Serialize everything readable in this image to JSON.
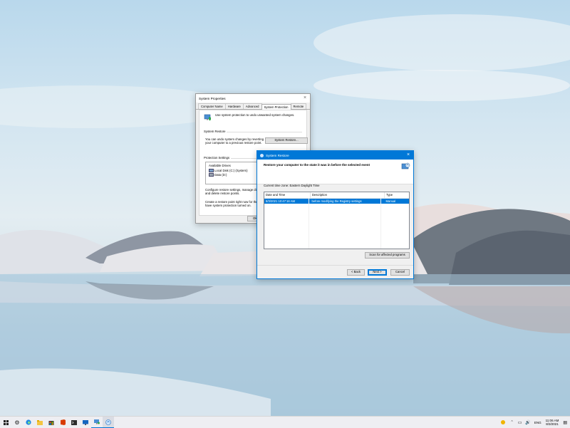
{
  "system_properties": {
    "title": "System Properties",
    "tabs": [
      "Computer Name",
      "Hardware",
      "Advanced",
      "System Protection",
      "Remote"
    ],
    "active_tab": "System Protection",
    "intro_text": "Use system protection to undo unwanted system changes.",
    "restore_section_label": "System Restore",
    "restore_text_1": "You can undo system changes by reverting",
    "restore_text_2": "your computer to a previous restore point.",
    "restore_button": "System Restore...",
    "protection_section_label": "Protection Settings",
    "drives_header": "Available Drives",
    "drives": [
      "Local Disk (C:) (System)",
      "Data (D:)"
    ],
    "configure_text_1": "Configure restore settings, manage disk",
    "configure_text_2": "and delete restore points.",
    "create_text_1": "Create a restore point right now for the d",
    "create_text_2": "have system protection turned on.",
    "ok_button": "OK"
  },
  "system_restore": {
    "title": "System Restore",
    "heading": "Restore your computer to the state it was in before the selected event",
    "timezone": "Current time zone: Eastern Daylight Time",
    "columns": [
      "Date and Time",
      "Description",
      "Type"
    ],
    "rows": [
      {
        "date": "8/3/2021 10:47:16 AM",
        "description": "before modifying the Registry settings",
        "type": "Manual"
      }
    ],
    "scan_button": "Scan for affected programs",
    "back_button": "< Back",
    "next_button": "Next >",
    "cancel_button": "Cancel"
  },
  "taskbar": {
    "icons": [
      "windows-icon",
      "settings-icon",
      "edge-icon",
      "file-explorer-icon",
      "store-icon",
      "office-icon",
      "terminal-icon",
      "remote-desktop-icon",
      "system-properties-icon",
      "system-restore-icon"
    ],
    "tray": {
      "language": "ENG",
      "time": "11:06 AM",
      "date": "8/3/2021"
    }
  },
  "colors": {
    "accent": "#0078d7",
    "selection": "#0078d7",
    "taskbar": "#eeeef2"
  }
}
